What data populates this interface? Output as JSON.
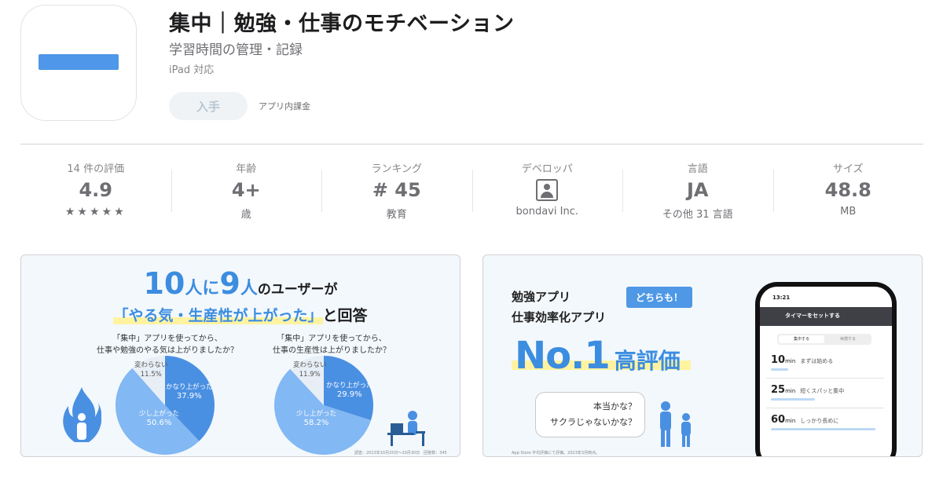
{
  "header": {
    "title": "集中｜勉強・仕事のモチベーション",
    "subtitle": "学習時間の管理・記録",
    "compat": "iPad 対応",
    "get_label": "入手",
    "iap_label": "アプリ内課金",
    "icon_color": "#4f97e8"
  },
  "info": {
    "rating": {
      "label": "14 件の評価",
      "value": "4.9",
      "stars": "★★★★★"
    },
    "age": {
      "label": "年齢",
      "value": "4+",
      "sub": "歳"
    },
    "ranking": {
      "label": "ランキング",
      "value": "# 45",
      "sub": "教育"
    },
    "developer": {
      "label": "デベロッパ",
      "sub": "bondavi Inc.",
      "icon": "person-square-icon"
    },
    "language": {
      "label": "言語",
      "value": "JA",
      "sub": "その他 31 言語"
    },
    "size": {
      "label": "サイズ",
      "value": "48.8",
      "sub": "MB"
    }
  },
  "screenshot1": {
    "headline": {
      "n1": "10",
      "unit1": "人に",
      "n2": "9",
      "unit2": "人",
      "rest": "のユーザーが"
    },
    "sub_highlight": "「やる気・生産性が上がった」",
    "sub_rest": "と回答",
    "q1": {
      "line1": "「集中」アプリを使ってから、",
      "line2": "仕事や勉強のやる気は上がりましたか？"
    },
    "q2": {
      "line1": "「集中」アプリを使ってから、",
      "line2": "仕事の生産性は上がりましたか？"
    },
    "pie1": [
      {
        "label": "かなり上がった",
        "pct": "37.9%",
        "value": 37.9,
        "color": "#4a90e2"
      },
      {
        "label": "少し上がった",
        "pct": "50.6%",
        "value": 50.6,
        "color": "#82b8f3"
      },
      {
        "label": "変わらない",
        "pct": "11.5%",
        "value": 11.5,
        "color": "#e8eef5"
      }
    ],
    "pie2": [
      {
        "label": "かなり上がった",
        "pct": "29.9%",
        "value": 29.9,
        "color": "#4a90e2"
      },
      {
        "label": "少し上がった",
        "pct": "58.2%",
        "value": 58.2,
        "color": "#82b8f3"
      },
      {
        "label": "変わらない",
        "pct": "11.9%",
        "value": 11.9,
        "color": "#e8eef5"
      }
    ],
    "footnote": "調査：2023年10月25日〜10月30日　回答数：345"
  },
  "screenshot2": {
    "line1": "勉強アプリ",
    "line2": "仕事効率化アプリ",
    "badge": "どちらも！",
    "no1": "No.1",
    "no1_rest": "高評価",
    "bubble1": "本当かな？",
    "bubble2": "サクラじゃないかな？",
    "footnote": "App Store 平均評価にて評価。2023年3月時点。",
    "phone": {
      "time": "13:21",
      "top_label": "タイマーをセットする",
      "seg_a": "集中する",
      "seg_b": "休憩する",
      "rows": [
        {
          "num": "10",
          "unit": "min",
          "desc": "まずは始める",
          "progress": 0.16
        },
        {
          "num": "25",
          "unit": "min",
          "desc": "短くスパッと集中",
          "progress": 0.4
        },
        {
          "num": "60",
          "unit": "min",
          "desc": "しっかり長めに",
          "progress": 0.95
        }
      ]
    }
  }
}
